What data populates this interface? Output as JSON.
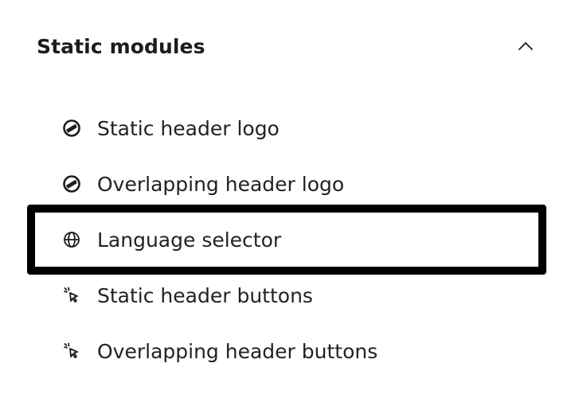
{
  "section": {
    "title": "Static modules",
    "expanded": true,
    "toggle_icon": "chevron-up-icon"
  },
  "modules": [
    {
      "label": "Static header logo",
      "icon": "logo-icon",
      "selected": false
    },
    {
      "label": "Overlapping header logo",
      "icon": "logo-icon",
      "selected": false
    },
    {
      "label": "Language selector",
      "icon": "globe-icon",
      "selected": true
    },
    {
      "label": "Static header buttons",
      "icon": "cursor-click-icon",
      "selected": false
    },
    {
      "label": "Overlapping header buttons",
      "icon": "cursor-click-icon",
      "selected": false
    }
  ],
  "colors": {
    "text": "#222222",
    "selection_border": "#000000",
    "background": "#ffffff"
  }
}
